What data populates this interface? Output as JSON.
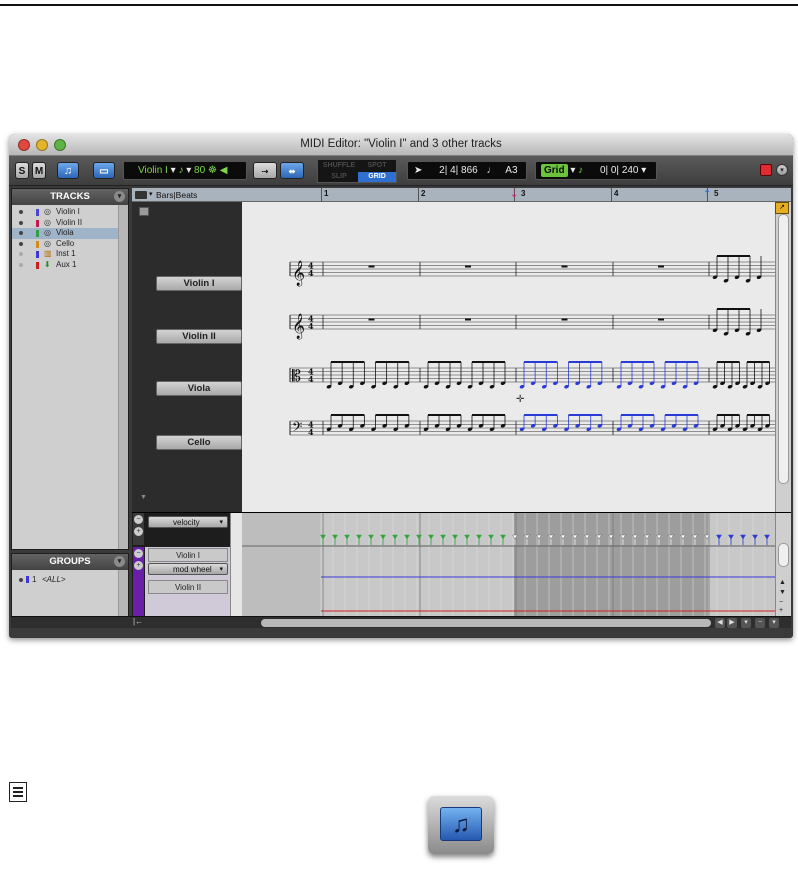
{
  "window": {
    "title": "MIDI Editor: \"Violin I\" and 3 other tracks"
  },
  "toolbar": {
    "solo_label": "S",
    "mute_label": "M",
    "track_selector": "Violin I",
    "velocity_value": "80",
    "edit_modes": [
      "SHUFFLE",
      "SPOT",
      "SLIP",
      "GRID"
    ],
    "active_mode": "GRID",
    "cursor_location": "2| 4| 866",
    "cursor_pitch": "A3",
    "grid_label": "Grid",
    "grid_value": "0| 0| 240"
  },
  "tracks_panel": {
    "header": "TRACKS",
    "items": [
      {
        "name": "Violin I",
        "color": "#4a44d8",
        "selected": false
      },
      {
        "name": "Violin II",
        "color": "#c21b4c",
        "selected": false
      },
      {
        "name": "Viola",
        "color": "#2f9f48",
        "selected": true
      },
      {
        "name": "Cello",
        "color": "#d68a1e",
        "selected": false
      },
      {
        "name": "Inst 1",
        "color": "#3a36d8",
        "selected": false
      },
      {
        "name": "Aux 1",
        "color": "#c8201c",
        "selected": false
      }
    ]
  },
  "groups_panel": {
    "header": "GROUPS",
    "items": [
      {
        "id": "1",
        "name": "<ALL>"
      }
    ]
  },
  "ruler": {
    "timebase": "Bars|Beats",
    "bars": [
      "1",
      "2",
      "3",
      "4",
      "5"
    ]
  },
  "staves": [
    {
      "name": "Violin I",
      "clef": "treble"
    },
    {
      "name": "Violin II",
      "clef": "treble"
    },
    {
      "name": "Viola",
      "clef": "alto"
    },
    {
      "name": "Cello",
      "clef": "bass"
    }
  ],
  "time_signature": "4/4",
  "controller_lanes": [
    {
      "controller": "velocity",
      "track": "Violin I"
    },
    {
      "controller": "mod wheel",
      "track": "Violin II"
    }
  ],
  "colors": {
    "selected_note": "#2a3ad6",
    "velocity_green": "#2ea73a",
    "velocity_blue": "#2a3ad6",
    "accent_blue": "#2f6fd0",
    "lcd_green": "#7fd64f"
  }
}
